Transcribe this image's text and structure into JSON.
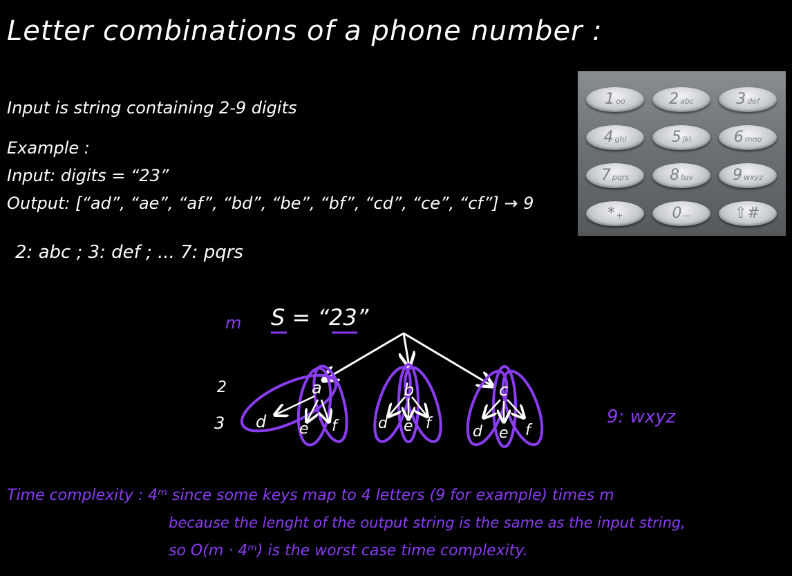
{
  "title": "Letter combinations of a phone number :",
  "lines": {
    "input_desc": "Input is string containing 2-9 digits",
    "example_label": "Example :",
    "input_example": "Input: digits = “23”",
    "output_example": "Output: [“ad”, “ae”, “af”, “bd”, “be”, “bf”, “cd”, “ce”, “cf”] → 9",
    "mapping": "2: abc ; 3: def ; ... 7: pqrs"
  },
  "keypad": [
    {
      "digit": "1",
      "letters": "οο"
    },
    {
      "digit": "2",
      "letters": "abc"
    },
    {
      "digit": "3",
      "letters": "def"
    },
    {
      "digit": "4",
      "letters": "ghi"
    },
    {
      "digit": "5",
      "letters": "jkl"
    },
    {
      "digit": "6",
      "letters": "mno"
    },
    {
      "digit": "7",
      "letters": "pqrs"
    },
    {
      "digit": "8",
      "letters": "tuv"
    },
    {
      "digit": "9",
      "letters": "wxyz"
    },
    {
      "digit": "*",
      "letters": "+"
    },
    {
      "digit": "0",
      "letters": "—"
    },
    {
      "digit": "⇧#",
      "letters": ""
    }
  ],
  "tree": {
    "m_label": "m",
    "root_label": "S = “23”",
    "level_labels": [
      "2",
      "3"
    ],
    "level1": [
      "a",
      "b",
      "c"
    ],
    "level2": [
      "d",
      "e",
      "f"
    ],
    "side_note": "9: wxyz"
  },
  "complexity": {
    "line1": "Time complexity : 4ᵐ since some keys map to 4 letters (9 for example) times m",
    "line2": "because the lenght of the output string is the same as the input string,",
    "line3": "so O(m · 4ᵐ) is the worst case time complexity."
  },
  "colors": {
    "background": "#000000",
    "ink": "#ffffff",
    "accent": "#8a3df0"
  }
}
